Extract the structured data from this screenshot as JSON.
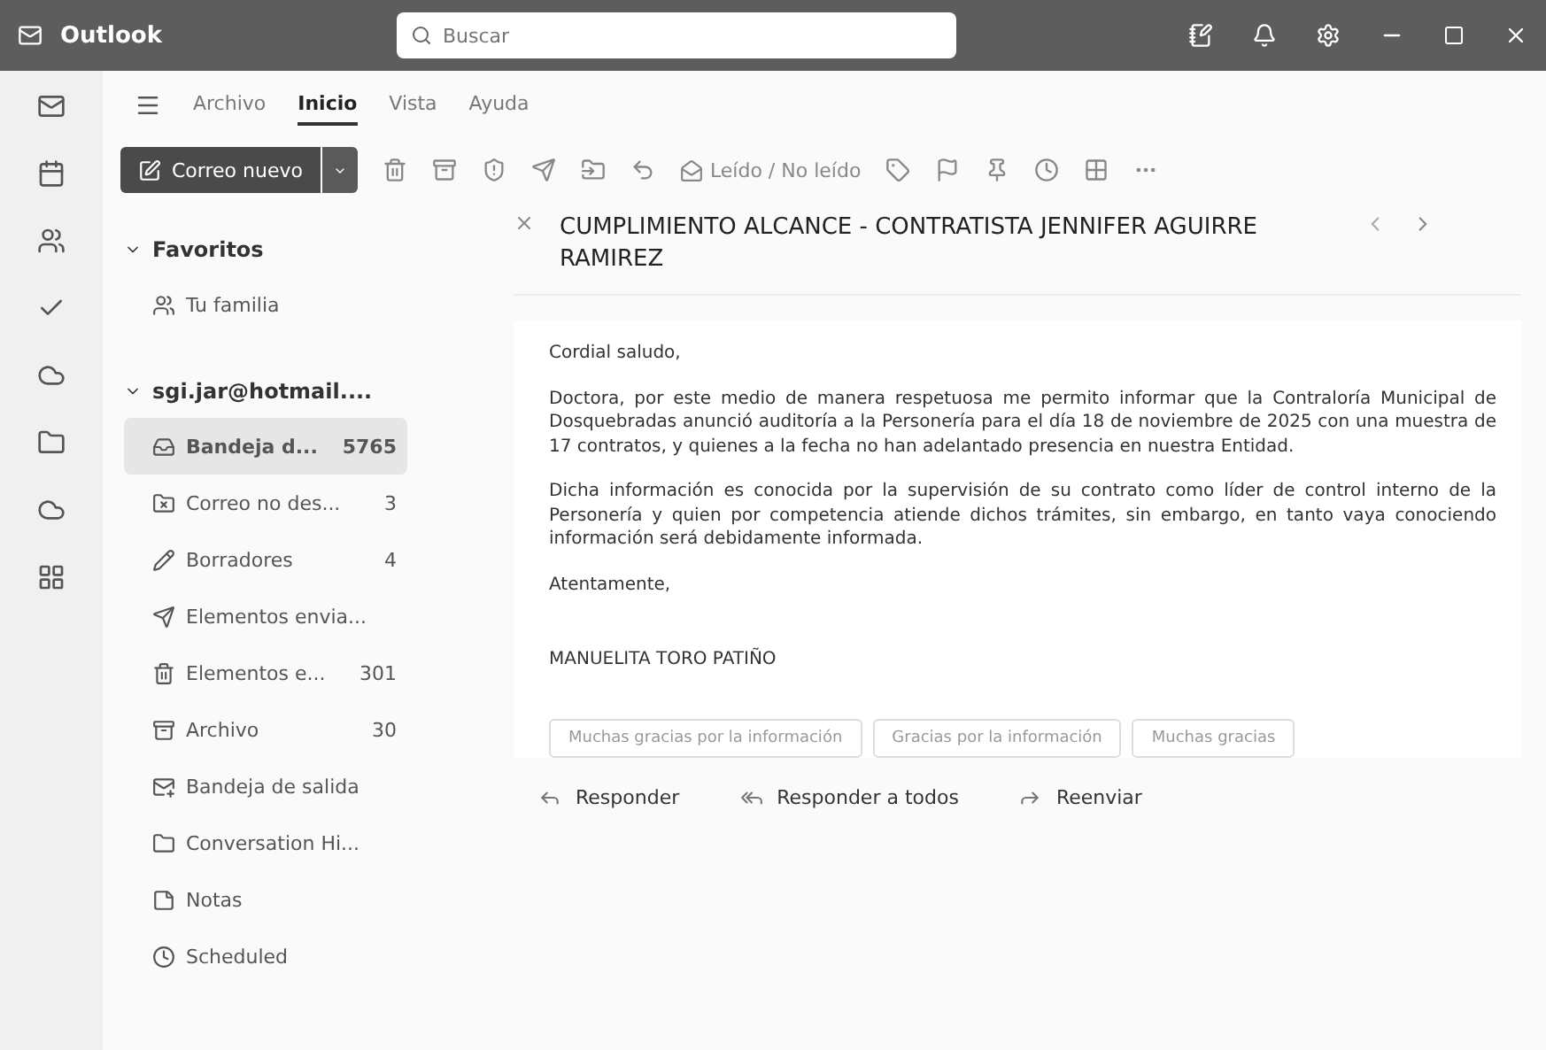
{
  "window": {
    "title": "Outlook"
  },
  "search": {
    "placeholder": "Buscar"
  },
  "menu_tabs": [
    {
      "label": "Archivo",
      "selected": false
    },
    {
      "label": "Inicio",
      "selected": true
    },
    {
      "label": "Vista",
      "selected": false
    },
    {
      "label": "Ayuda",
      "selected": false
    }
  ],
  "toolbar": {
    "new_mail": "Correo nuevo",
    "read_unread": "Leído / No leído"
  },
  "sidebar": {
    "favorites": {
      "label": "Favoritos",
      "expanded": true,
      "items": [
        {
          "kind": "family",
          "label": "Tu familia",
          "selected": false
        }
      ]
    },
    "account": {
      "label": "sgi.jar@hotmail....",
      "expanded": true,
      "items": [
        {
          "kind": "inbox",
          "label": "Bandeja d...",
          "count": "5765",
          "selected": true
        },
        {
          "kind": "junk",
          "label": "Correo no des...",
          "count": "3",
          "selected": false
        },
        {
          "kind": "drafts",
          "label": "Borradores",
          "count": "4",
          "selected": false
        },
        {
          "kind": "sent",
          "label": "Elementos envia...",
          "selected": false
        },
        {
          "kind": "deleted",
          "label": "Elementos e...",
          "count": "301",
          "selected": false
        },
        {
          "kind": "archive",
          "label": "Archivo",
          "count": "30",
          "selected": false
        },
        {
          "kind": "outbox",
          "label": "Bandeja de salida",
          "selected": false
        },
        {
          "kind": "folder",
          "label": "Conversation Hi...",
          "selected": false
        },
        {
          "kind": "notes",
          "label": "Notas",
          "selected": false
        },
        {
          "kind": "scheduled",
          "label": "Scheduled",
          "selected": false
        }
      ]
    }
  },
  "message": {
    "subject": "CUMPLIMIENTO ALCANCE - CONTRATISTA JENNIFER AGUIRRE RAMIREZ",
    "paragraphs": [
      "Cordial saludo,",
      "Doctora, por este medio de manera respetuosa me permito informar que la Contraloría Municipal de Dosquebradas anunció auditoría a la Personería para el día 18 de noviembre de 2025 con una muestra de 17 contratos, y quienes a la fecha no han adelantado presencia en nuestra Entidad.",
      "Dicha información es conocida por la supervisión de su contrato como líder de control interno de la Personería y quien por competencia atiende dichos trámites, sin embargo, en tanto vaya conociendo información será debidamente informada.",
      "Atentamente,"
    ],
    "signature": "MANUELITA TORO PATIÑO",
    "suggested_replies": [
      "Muchas gracias por la información",
      "Gracias por la información",
      "Muchas gracias"
    ],
    "actions": [
      {
        "kind": "reply",
        "label": "Responder"
      },
      {
        "kind": "reply_all",
        "label": "Responder a todos"
      },
      {
        "kind": "forward",
        "label": "Reenviar"
      }
    ]
  }
}
